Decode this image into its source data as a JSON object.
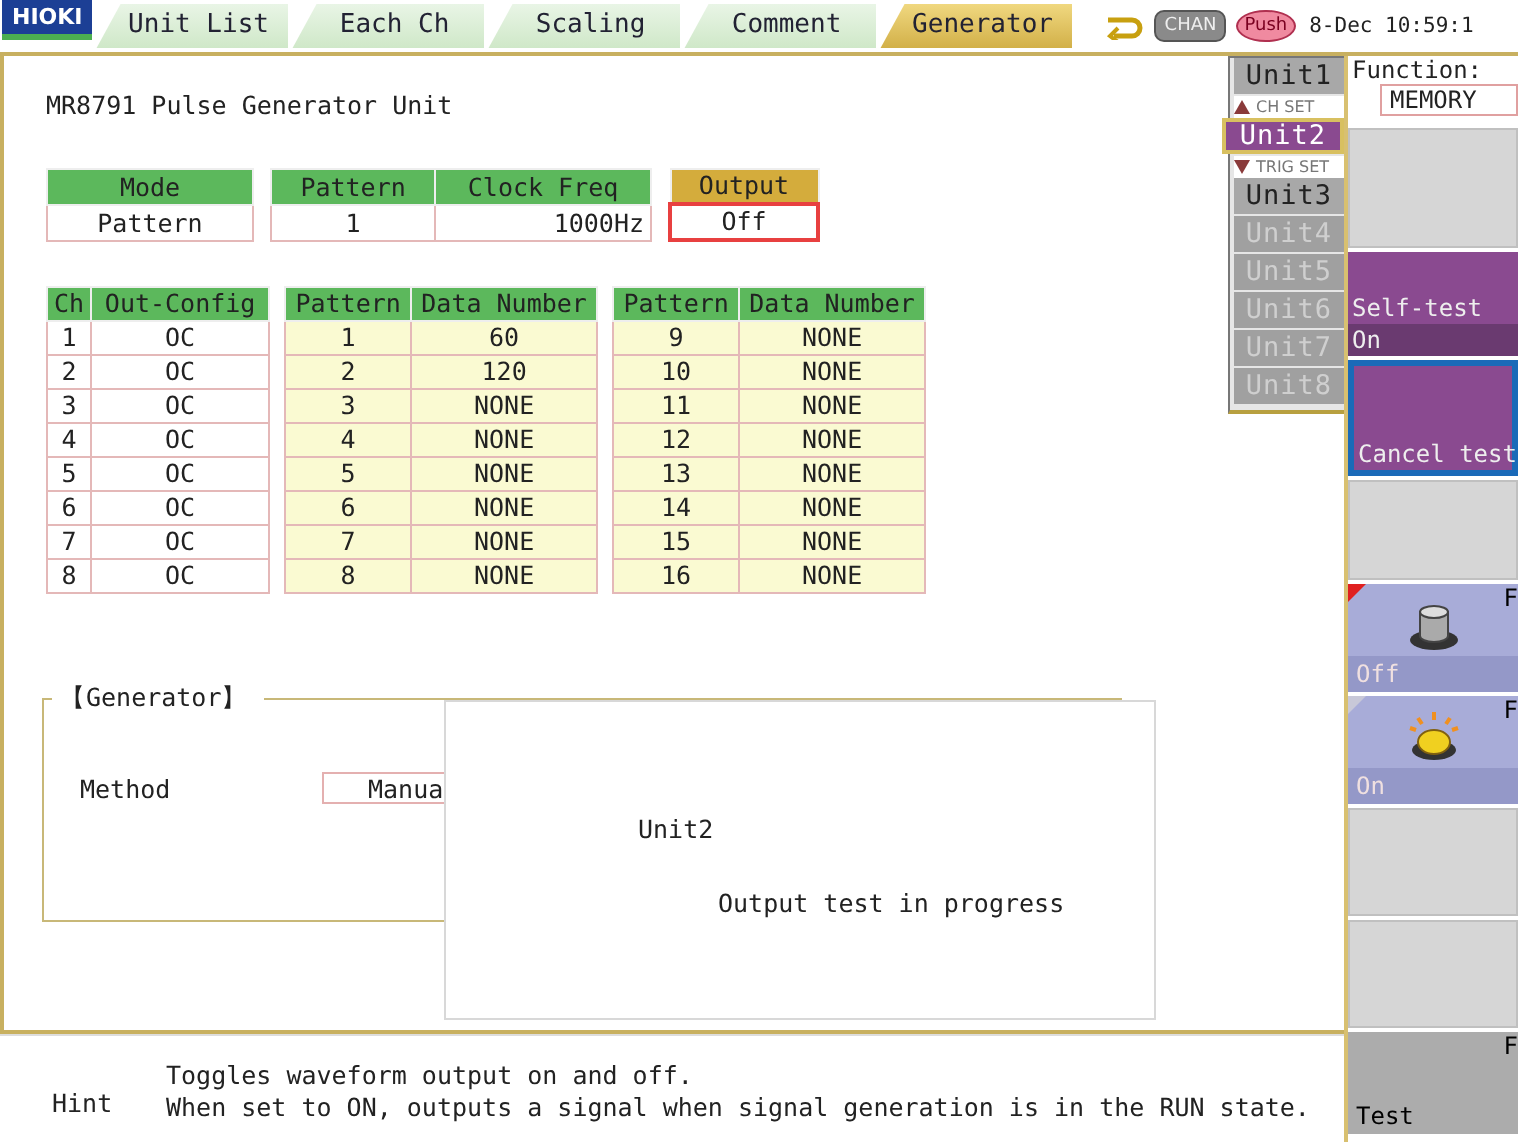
{
  "tab_bar": {
    "logo": "HIOKI",
    "tabs": [
      {
        "label": "Unit List",
        "selected": false
      },
      {
        "label": "Each Ch",
        "selected": false
      },
      {
        "label": "Scaling",
        "selected": false
      },
      {
        "label": "Comment",
        "selected": false
      },
      {
        "label": "Generator",
        "selected": true
      }
    ],
    "chan_key": "CHAN",
    "push_badge": "Push",
    "datetime": "8-Dec 10:59:1"
  },
  "main": {
    "title": "MR8791 Pulse Generator Unit",
    "setting_groups": [
      {
        "fields": [
          {
            "header": "Mode",
            "value": "Pattern",
            "focused": false
          }
        ]
      },
      {
        "fields": [
          {
            "header": "Pattern",
            "value": "1",
            "focused": false
          },
          {
            "header": "Clock Freq",
            "value": "1000Hz",
            "focused": false
          }
        ]
      },
      {
        "fields": [
          {
            "header": "Output",
            "value": "Off",
            "focused": true
          }
        ]
      }
    ],
    "tables": [
      {
        "columns": [
          "Ch",
          "Out-Config"
        ],
        "rows": [
          [
            "1",
            "OC"
          ],
          [
            "2",
            "OC"
          ],
          [
            "3",
            "OC"
          ],
          [
            "4",
            "OC"
          ],
          [
            "5",
            "OC"
          ],
          [
            "6",
            "OC"
          ],
          [
            "7",
            "OC"
          ],
          [
            "8",
            "OC"
          ]
        ]
      },
      {
        "columns": [
          "Pattern",
          "Data Number"
        ],
        "rows": [
          [
            "1",
            "60"
          ],
          [
            "2",
            "120"
          ],
          [
            "3",
            "NONE"
          ],
          [
            "4",
            "NONE"
          ],
          [
            "5",
            "NONE"
          ],
          [
            "6",
            "NONE"
          ],
          [
            "7",
            "NONE"
          ],
          [
            "8",
            "NONE"
          ]
        ]
      },
      {
        "columns": [
          "Pattern",
          "Data Number"
        ],
        "rows": [
          [
            "9",
            "NONE"
          ],
          [
            "10",
            "NONE"
          ],
          [
            "11",
            "NONE"
          ],
          [
            "12",
            "NONE"
          ],
          [
            "13",
            "NONE"
          ],
          [
            "14",
            "NONE"
          ],
          [
            "15",
            "NONE"
          ],
          [
            "16",
            "NONE"
          ]
        ]
      }
    ],
    "generator": {
      "title": "【Generator】",
      "method_label": "Method",
      "method_value": "Manua"
    },
    "dialog": {
      "unit": "Unit2",
      "message": "Output test in progress"
    }
  },
  "unit_list": {
    "ch_set_label": "CH SET",
    "trig_set_label": "TRIG SET",
    "units": [
      {
        "label": "Unit1",
        "selected": false,
        "disabled": false
      },
      {
        "label": "Unit2",
        "selected": true,
        "disabled": false
      },
      {
        "label": "Unit3",
        "selected": false,
        "disabled": false
      },
      {
        "label": "Unit4",
        "selected": false,
        "disabled": true
      },
      {
        "label": "Unit5",
        "selected": false,
        "disabled": true
      },
      {
        "label": "Unit6",
        "selected": false,
        "disabled": true
      },
      {
        "label": "Unit7",
        "selected": false,
        "disabled": true
      },
      {
        "label": "Unit8",
        "selected": false,
        "disabled": true
      }
    ]
  },
  "side": {
    "function": {
      "label": "Function:",
      "value": "MEMORY"
    },
    "soft_keys": [
      {
        "kind": "blank",
        "selected": false
      },
      {
        "kind": "menu",
        "label": "Self-test",
        "value": "On",
        "selected": false
      },
      {
        "kind": "menu",
        "label": "Cancel test",
        "selected": true
      },
      {
        "kind": "blank",
        "selected": false
      },
      {
        "kind": "lamp",
        "key": "F",
        "value": "Off",
        "lit": false,
        "selected": true
      },
      {
        "kind": "lamp",
        "key": "F",
        "value": "On",
        "lit": true,
        "selected": false
      },
      {
        "kind": "blank",
        "selected": false
      },
      {
        "kind": "blank",
        "selected": false
      },
      {
        "kind": "command",
        "key": "F",
        "label": "Test",
        "selected": false
      }
    ]
  },
  "hint": {
    "label": "Hint",
    "lines": [
      "Toggles waveform output on and off.",
      "When set to ON, outputs a signal when signal generation is in the RUN state."
    ]
  }
}
